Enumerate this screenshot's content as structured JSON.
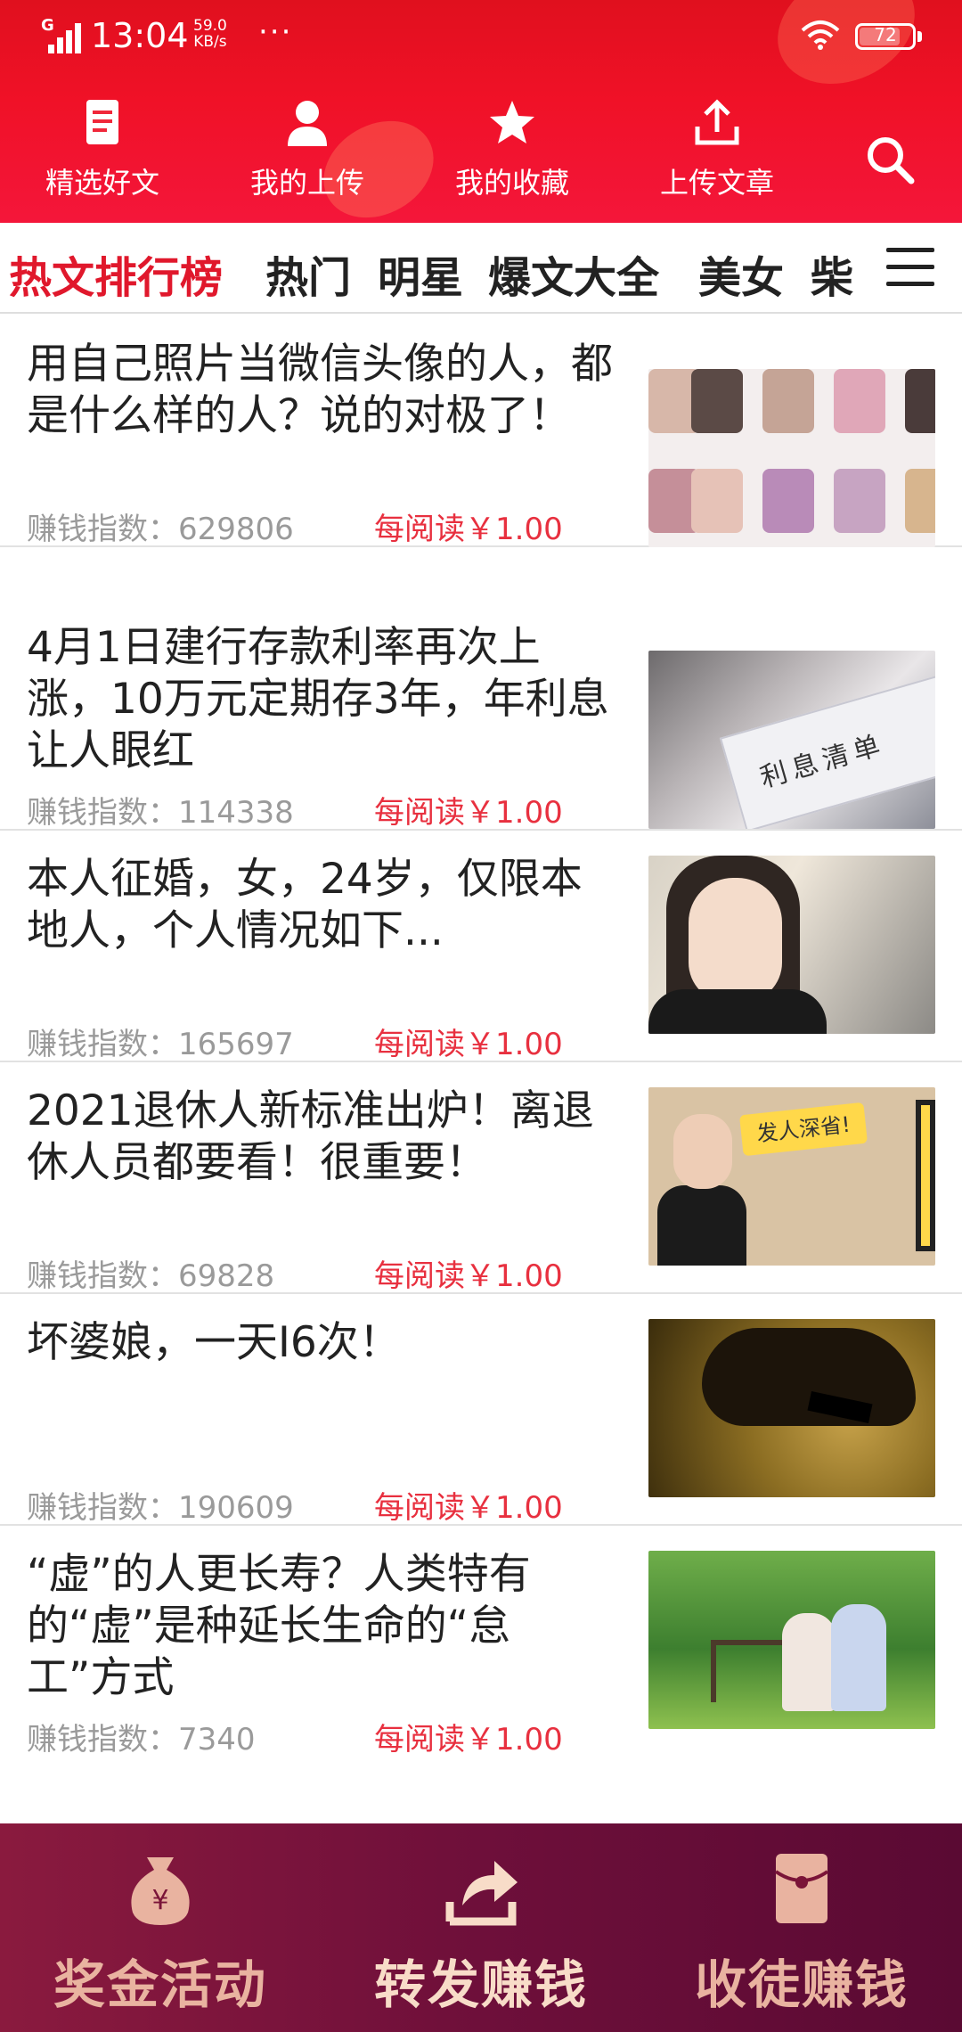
{
  "status_bar": {
    "network": "G",
    "time": "13:04",
    "speed_value": "59.0",
    "speed_unit": "KB/s",
    "more": "···",
    "battery": "72"
  },
  "top_nav": [
    {
      "label": "精选好文",
      "icon": "article-icon"
    },
    {
      "label": "我的上传",
      "icon": "user-icon"
    },
    {
      "label": "我的收藏",
      "icon": "star-icon"
    },
    {
      "label": "上传文章",
      "icon": "upload-icon"
    }
  ],
  "search_icon": "search-icon",
  "tabs": [
    "热文排行榜",
    "热门",
    "明星",
    "爆文大全",
    "美女",
    "柴"
  ],
  "active_tab": "热文排行榜",
  "list_labels": {
    "index_label": "赚钱指数：",
    "reward": "每阅读￥1.00"
  },
  "articles": [
    {
      "title": "用自己照片当微信头像的人，都是什么样的人？说的对极了！",
      "index": "629806"
    },
    {
      "title": "4月1日建行存款利率再次上涨，10万元定期存3年，年利息让人眼红",
      "index": "114338"
    },
    {
      "title": "本人征婚，女，24岁，仅限本地人，个人情况如下...",
      "index": "165697"
    },
    {
      "title": "2021退休人新标准出炉！离退休人员都要看！很重要！",
      "index": "69828"
    },
    {
      "title": "坏婆娘，一天I6次！",
      "index": "190609"
    },
    {
      "title": "“虚”的人更长寿？人类特有的“虚”是种延长生命的“怠工”方式",
      "index": "7340"
    }
  ],
  "thumb_texts": {
    "receipt": "利息清单",
    "tag": "发人深省!"
  },
  "bottom_bar": [
    {
      "label": "奖金活动",
      "icon": "money-bag-icon"
    },
    {
      "label": "转发赚钱",
      "icon": "share-icon"
    },
    {
      "label": "收徒赚钱",
      "icon": "red-envelope-icon"
    }
  ],
  "colors": {
    "header": "#f01127",
    "active_tab": "#e0182c",
    "reward": "#e8303f",
    "bottom_bar": "#6e0f3a",
    "bottom_label": "#e9b3a0"
  }
}
